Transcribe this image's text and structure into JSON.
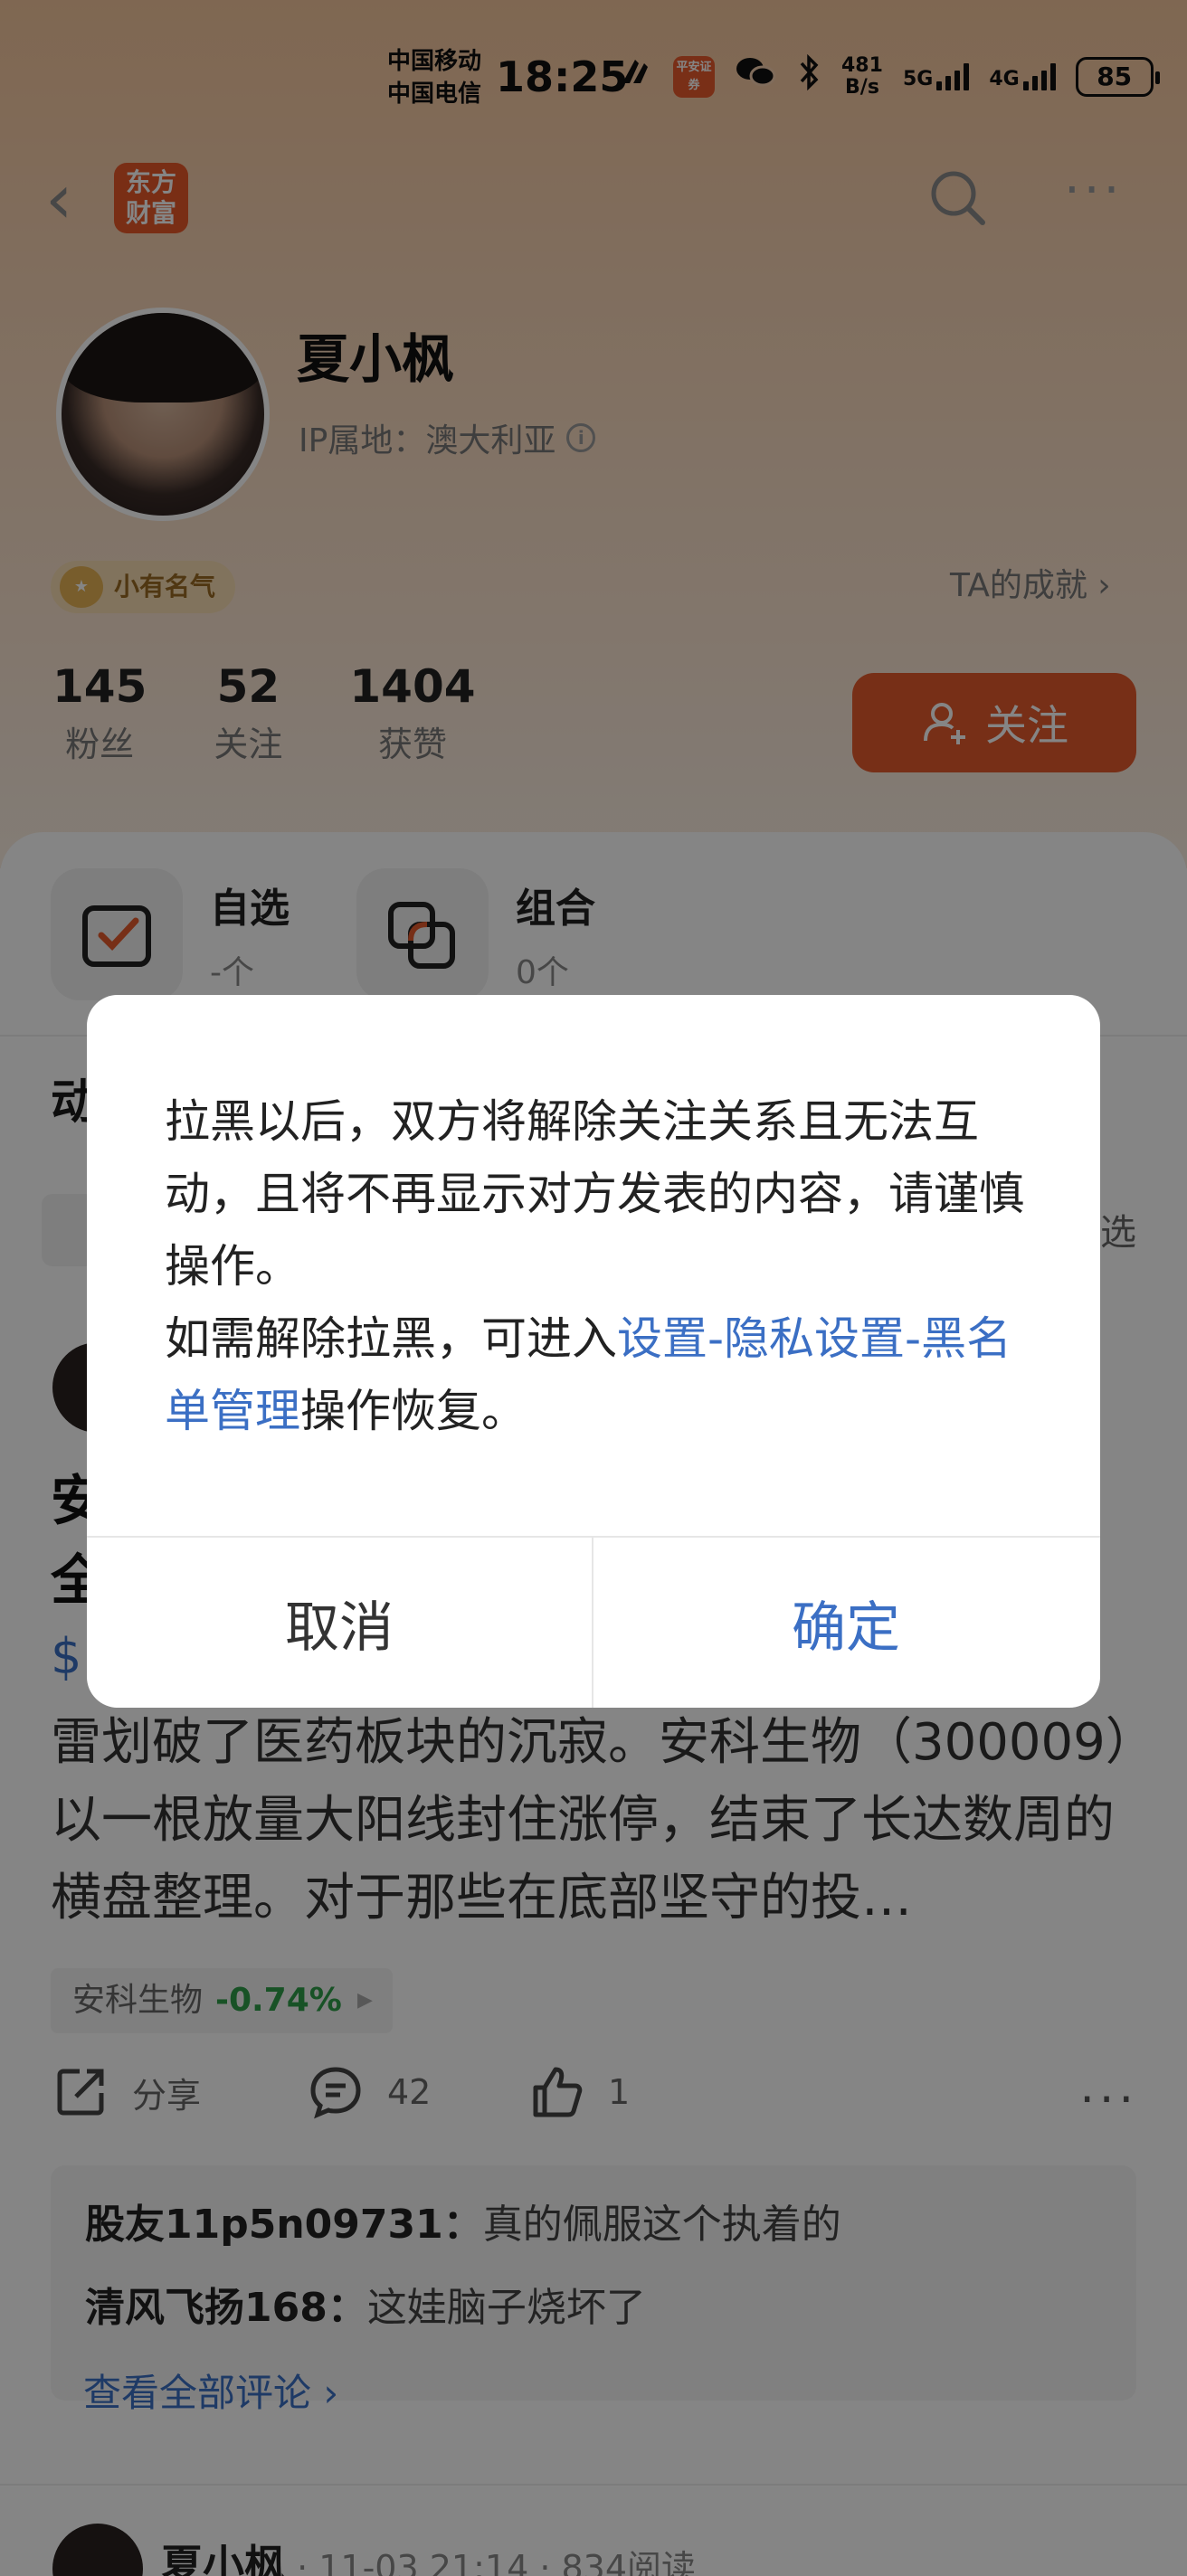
{
  "status_bar": {
    "carrier1": "中国移动",
    "carrier2": "中国电信",
    "time": "18:25",
    "app_badge": "平安证券",
    "net_speed_value": "481",
    "net_speed_unit": "B/s",
    "net1": "5G",
    "net2": "4G",
    "battery": "85"
  },
  "nav": {
    "logo_line1": "东方",
    "logo_line2": "财富"
  },
  "profile": {
    "name": "夏小枫",
    "ip_location": "IP属地：澳大利亚",
    "badge": "小有名气",
    "achievements": "TA的成就 ›",
    "stats": [
      {
        "value": "145",
        "label": "粉丝"
      },
      {
        "value": "52",
        "label": "关注"
      },
      {
        "value": "1404",
        "label": "获赞"
      }
    ],
    "follow_label": "关注"
  },
  "tiles": [
    {
      "title": "自选",
      "sub": "-个"
    },
    {
      "title": "组合",
      "sub": "0个"
    }
  ],
  "feed": {
    "tab_label": "动",
    "filter_label": "选",
    "post_title": "安 全",
    "post_dollar": "$",
    "post_body": "雷划破了医药板块的沉寂。安科生物（300009）以一根放量大阳线封住涨停，结束了长达数周的横盘整理。对于那些在底部坚守的投…",
    "stock_name": "安科生物",
    "stock_change": "-0.74%",
    "share_label": "分享",
    "comment_count": "42",
    "like_count": "1",
    "comments": [
      {
        "user": "股友11p5n09731：",
        "text": "真的佩服这个执着的"
      },
      {
        "user": "清风飞扬168：",
        "text": "这娃脑子烧坏了"
      }
    ],
    "see_all": "查看全部评论 ›",
    "post2_author": "夏小枫",
    "post2_meta": " · 11-03 21:14 · 834阅读"
  },
  "dialog": {
    "text1": "拉黑以后，双方将解除关注关系且无法互动，且将不再显示对方发表的内容，请谨慎操作。",
    "text2_prefix": "如需解除拉黑，可进入",
    "text2_link": "设置-隐私设置-黑名单管理",
    "text2_suffix": "操作恢复。",
    "cancel": "取消",
    "confirm": "确定"
  },
  "colors": {
    "accent": "#e45a2c",
    "link": "#3b6fc4",
    "stock_down": "#2f9e4a"
  }
}
